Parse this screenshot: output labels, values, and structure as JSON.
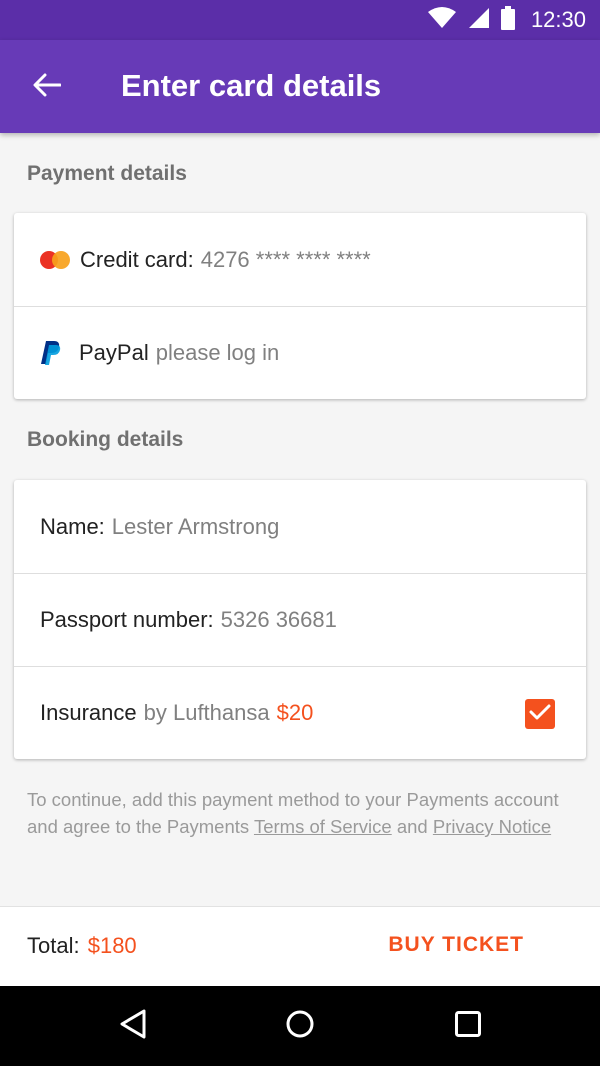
{
  "status_bar": {
    "time": "12:30"
  },
  "app_bar": {
    "title": "Enter card details"
  },
  "payment_section": {
    "header": "Payment details",
    "credit_card": {
      "label": "Credit card:",
      "value": "4276 **** **** ****"
    },
    "paypal": {
      "label": "PayPal",
      "value": "please log in"
    }
  },
  "booking_section": {
    "header": "Booking details",
    "name": {
      "label": "Name:",
      "value": "Lester Armstrong"
    },
    "passport": {
      "label": "Passport number:",
      "value": "5326 36681"
    },
    "insurance": {
      "label": "Insurance",
      "by": "by Lufthansa",
      "price": "$20",
      "checked": true
    }
  },
  "terms": {
    "prefix": "To continue, add this payment method to your Payments account and agree to the Payments ",
    "tos_link": "Terms of Service",
    "and": " and ",
    "privacy_link": "Privacy Notice"
  },
  "footer": {
    "total_label": "Total:",
    "total_value": "$180",
    "buy_label": "BUY TICKET"
  },
  "colors": {
    "primary": "#673ab7",
    "primary_dark": "#5b2ea8",
    "accent": "#f4511e"
  },
  "icons": [
    "wifi-icon",
    "signal-icon",
    "battery-icon",
    "back-arrow-icon",
    "mastercard-icon",
    "paypal-icon",
    "checkmark-icon",
    "nav-back-icon",
    "nav-home-icon",
    "nav-recents-icon"
  ]
}
